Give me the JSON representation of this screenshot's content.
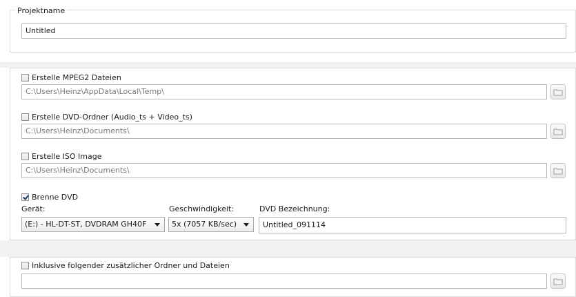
{
  "project": {
    "legend": "Projektname",
    "name_value": "Untitled"
  },
  "mpeg2": {
    "label": "Erstelle MPEG2 Dateien",
    "checked": false,
    "path": "C:\\Users\\Heinz\\AppData\\Local\\Temp\\"
  },
  "dvd_folder": {
    "label": "Erstelle DVD-Ordner (Audio_ts + Video_ts)",
    "checked": false,
    "path": "C:\\Users\\Heinz\\Documents\\"
  },
  "iso": {
    "label": "Erstelle ISO Image",
    "checked": false,
    "path": "C:\\Users\\Heinz\\Documents\\"
  },
  "burn": {
    "label": "Brenne DVD",
    "checked": true,
    "device_label": "Gerät:",
    "device_value": "(E:) - HL-DT-ST, DVDRAM GH40F",
    "speed_label": "Geschwindigkeit:",
    "speed_value": "5x (7057 KB/sec)",
    "title_label": "DVD Bezeichnung:",
    "title_value": "Untitled_091114"
  },
  "extra": {
    "label": "Inklusive folgender zusätzlicher Ordner und Dateien",
    "checked": false,
    "path": ""
  },
  "icons": {
    "folder": "folder-icon",
    "dropdown": "chevron-down-icon",
    "checkbox": "checkbox-icon"
  },
  "colors": {
    "background": "#ffffff",
    "band": "#f1f1f1",
    "border": "#d9d9d9",
    "check": "#1f3c6d"
  }
}
